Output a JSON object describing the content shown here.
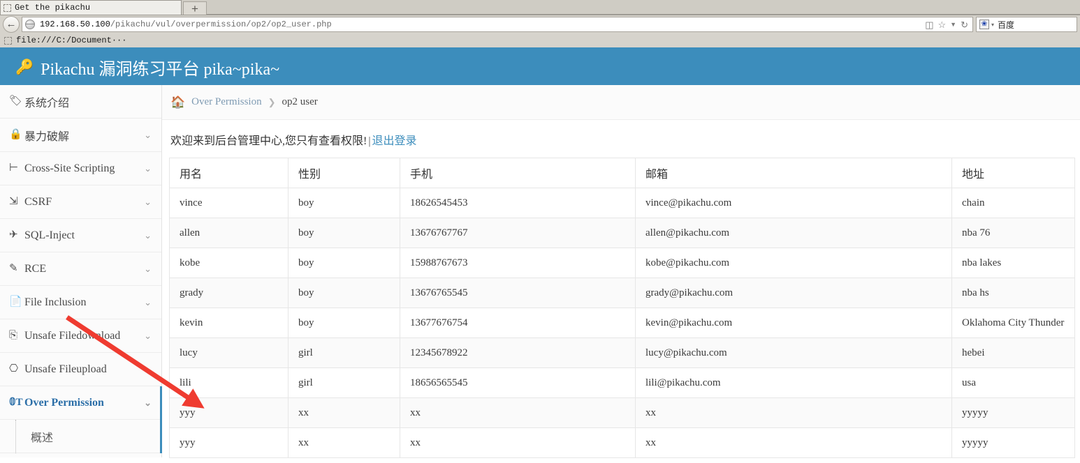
{
  "browser": {
    "tab": {
      "title": "Get the pikachu",
      "favicon": "page-icon"
    },
    "new_tab_label": "+",
    "url_host": "192.168.50.100",
    "url_path": "/pikachu/vul/overpermission/op2/op2_user.php",
    "toolbar_icons": [
      "reader-icon",
      "star-icon",
      "chevron-down-icon",
      "reload-icon"
    ],
    "search_engine_label": "百度",
    "search_caret": "▾",
    "bookmark": {
      "label": "file:///C:/Document···",
      "icon": "page-icon"
    },
    "back_arrow": "←"
  },
  "header": {
    "icon": "key-icon",
    "title": "Pikachu 漏洞练习平台 pika~pika~",
    "brand_color": "#3c8dbc"
  },
  "sidebar": {
    "items": [
      {
        "label": "系统介绍",
        "icon": "tag-icon",
        "caret": "",
        "active": false,
        "has_caret": false
      },
      {
        "label": "暴力破解",
        "icon": "lock-icon",
        "caret": "⌄",
        "active": false,
        "has_caret": true
      },
      {
        "label": "Cross-Site Scripting",
        "icon": "list-icon",
        "caret": "⌄",
        "active": false,
        "has_caret": true
      },
      {
        "label": "CSRF",
        "icon": "share-icon",
        "caret": "⌄",
        "active": false,
        "has_caret": true
      },
      {
        "label": "SQL-Inject",
        "icon": "plane-icon",
        "caret": "⌄",
        "active": false,
        "has_caret": true
      },
      {
        "label": "RCE",
        "icon": "pencil-icon",
        "caret": "⌄",
        "active": false,
        "has_caret": true
      },
      {
        "label": "File Inclusion",
        "icon": "file-icon",
        "caret": "⌄",
        "active": false,
        "has_caret": true
      },
      {
        "label": "Unsafe Filedownload",
        "icon": "download-icon",
        "caret": "⌄",
        "active": false,
        "has_caret": true
      },
      {
        "label": "Unsafe Fileupload",
        "icon": "upload-icon",
        "caret": "⌄",
        "active": false,
        "has_caret": true
      },
      {
        "label": "Over Permission",
        "icon": "it-icon",
        "caret": "⌄",
        "active": true,
        "has_caret": true
      }
    ],
    "submenu": [
      {
        "label": "概述"
      }
    ]
  },
  "breadcrumb": {
    "home_icon": "home-icon",
    "link": "Over Permission",
    "separator": "❯",
    "current": "op2 user"
  },
  "main": {
    "welcome_text": "欢迎来到后台管理中心,您只有查看权限!",
    "pipe": "|",
    "logout_label": "退出登录",
    "table": {
      "columns": [
        "用名",
        "性别",
        "手机",
        "邮箱",
        "地址"
      ],
      "rows": [
        [
          "vince",
          "boy",
          "18626545453",
          "vince@pikachu.com",
          "chain"
        ],
        [
          "allen",
          "boy",
          "13676767767",
          "allen@pikachu.com",
          "nba 76"
        ],
        [
          "kobe",
          "boy",
          "15988767673",
          "kobe@pikachu.com",
          "nba lakes"
        ],
        [
          "grady",
          "boy",
          "13676765545",
          "grady@pikachu.com",
          "nba hs"
        ],
        [
          "kevin",
          "boy",
          "13677676754",
          "kevin@pikachu.com",
          "Oklahoma City Thunder"
        ],
        [
          "lucy",
          "girl",
          "12345678922",
          "lucy@pikachu.com",
          "hebei"
        ],
        [
          "lili",
          "girl",
          "18656565545",
          "lili@pikachu.com",
          "usa"
        ],
        [
          "yyy",
          "xx",
          "xx",
          "xx",
          "yyyyy"
        ],
        [
          "yyy",
          "xx",
          "xx",
          "xx",
          "yyyyy"
        ]
      ]
    }
  },
  "annotation": {
    "arrow_color": "#ef3b30",
    "arrow_name": "red-pointer-arrow"
  }
}
